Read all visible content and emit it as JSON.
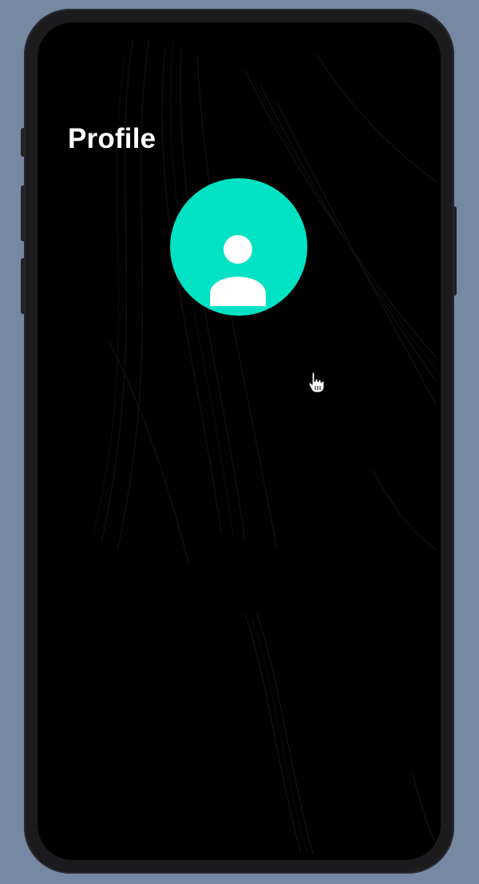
{
  "screen": {
    "title": "Profile"
  },
  "profile": {
    "avatar_icon": "user-silhouette-icon",
    "avatar_color": "#00e2c3"
  },
  "pointer": {
    "icon": "hand-pointer-cursor-icon"
  },
  "colors": {
    "background": "#7788a3",
    "device_frame": "#1b1b1d",
    "screen": "#000000",
    "title_text": "#ffffff"
  }
}
